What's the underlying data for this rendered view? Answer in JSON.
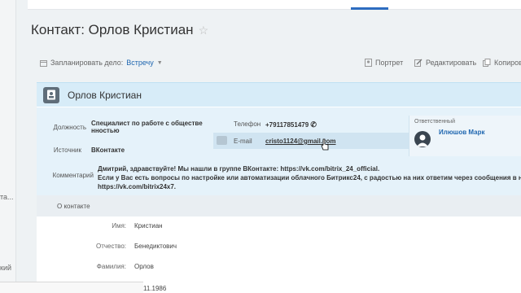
{
  "page": {
    "title": "Контакт: Орлов Кристиан"
  },
  "left_gutter": {
    "text1": "та...",
    "text2": "кий"
  },
  "toolbar": {
    "plan_label": "Запланировать дело:",
    "plan_value": "Встречу",
    "portrait": "Портрет",
    "edit": "Редактировать",
    "copy": "Копиров"
  },
  "card": {
    "header_name": "Орлов Кристиан",
    "position_label": "Должность",
    "position_value_line1": "Специалист по работе с обществе",
    "position_value_line2": "нностью",
    "source_label": "Источник",
    "source_value": "ВКонтакте",
    "phone_label": "Телефон",
    "phone_value": "+79117851479",
    "email_label": "E-mail",
    "email_value": "cristo1124@gmail.com",
    "responsible_label": "Ответственный",
    "responsible_name": "Илюшов Марк",
    "comment_label": "Комментарий",
    "comment_line1": "Дмитрий, здравствуйте! Мы нашли в группе ВКонтакте: https://vk.com/bitrix_24_official.",
    "comment_line2": "Если у Вас есть вопросы по настройке или автоматизации облачного Битрикс24, с радостью на них ответим через сообщения в наш",
    "comment_line3": "https://vk.com/bitrix24x7."
  },
  "about": {
    "header": "О контакте",
    "fields": [
      {
        "label": "Имя:",
        "value": "Кристиан"
      },
      {
        "label": "Отчество:",
        "value": "Бенедиктович"
      },
      {
        "label": "Фамилия:",
        "value": "Орлов"
      }
    ],
    "partial_date": "11.1986"
  }
}
